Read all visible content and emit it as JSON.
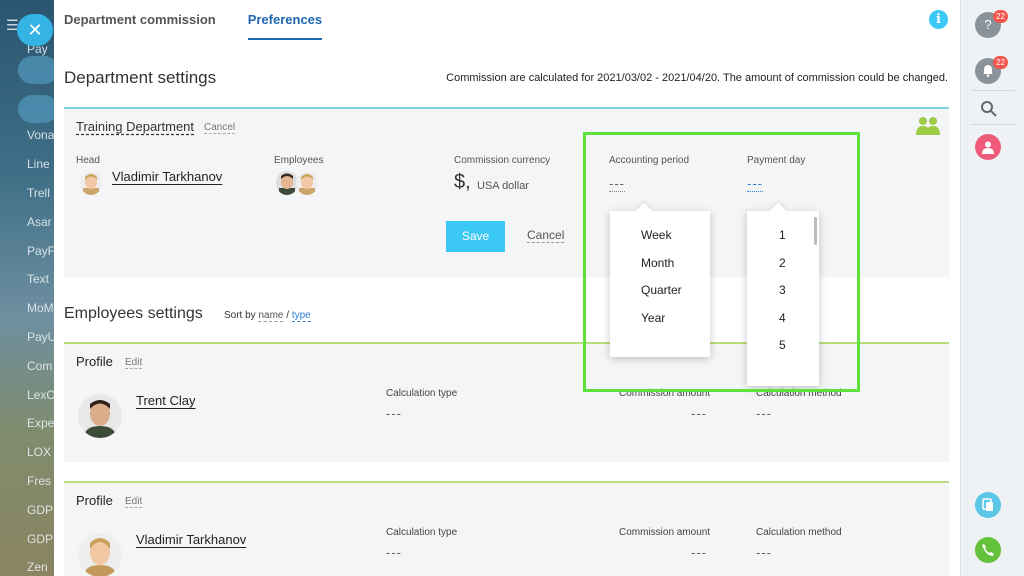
{
  "background_apps": [
    "Pay",
    "Vona",
    "Line",
    "Trell",
    "Asar",
    "PayF",
    "Text",
    "MoM",
    "PayU",
    "Com",
    "LexO",
    "Expe",
    "LOX",
    "Fres",
    "GDP",
    "GDP",
    "Zen"
  ],
  "tabs": [
    {
      "label": "Department commission",
      "active": false
    },
    {
      "label": "Preferences",
      "active": true
    }
  ],
  "department_section": {
    "title": "Department settings",
    "note": "Commission are calculated for 2021/03/02 - 2021/04/20. The amount of commission could be changed.",
    "department": {
      "name": "Training Department",
      "cancel_label": "Cancel",
      "head_label": "Head",
      "head_name": "Vladimir Tarkhanov",
      "employees_label": "Employees",
      "currency_label": "Commission currency",
      "currency_symbol": "$,",
      "currency_name": "USA dollar",
      "period_label": "Accounting period",
      "period_value": "---",
      "payday_label": "Payment day",
      "payday_value": "---",
      "save_label": "Save",
      "cancel_link_label": "Cancel"
    }
  },
  "period_options": [
    "Week",
    "Month",
    "Quarter",
    "Year"
  ],
  "payday_options": [
    "1",
    "2",
    "3",
    "4",
    "5"
  ],
  "employees_section": {
    "title": "Employees settings",
    "sort_prefix": "Sort by",
    "sort_name": "name",
    "sort_sep": "/",
    "sort_type": "type"
  },
  "employees": [
    {
      "profile_label": "Profile",
      "edit_label": "Edit",
      "name": "Trent Clay",
      "calc_type_label": "Calculation type",
      "calc_type_value": "---",
      "amount_label": "Commission amount",
      "amount_value": "---",
      "method_label": "Calculation method",
      "method_value": "---"
    },
    {
      "profile_label": "Profile",
      "edit_label": "Edit",
      "name": "Vladimir Tarkhanov",
      "calc_type_label": "Calculation type",
      "calc_type_value": "---",
      "amount_label": "Commission amount",
      "amount_value": "---",
      "method_label": "Calculation method",
      "method_value": "---"
    }
  ],
  "right_bar": {
    "help_badge": "22",
    "notif_badge": "22"
  },
  "colors": {
    "accent": "#3bc8f5",
    "tab_active": "#2067b0",
    "highlight": "#5ee13a",
    "dept_border": "#7dd1e0",
    "emp_border": "#b8dd7e"
  }
}
